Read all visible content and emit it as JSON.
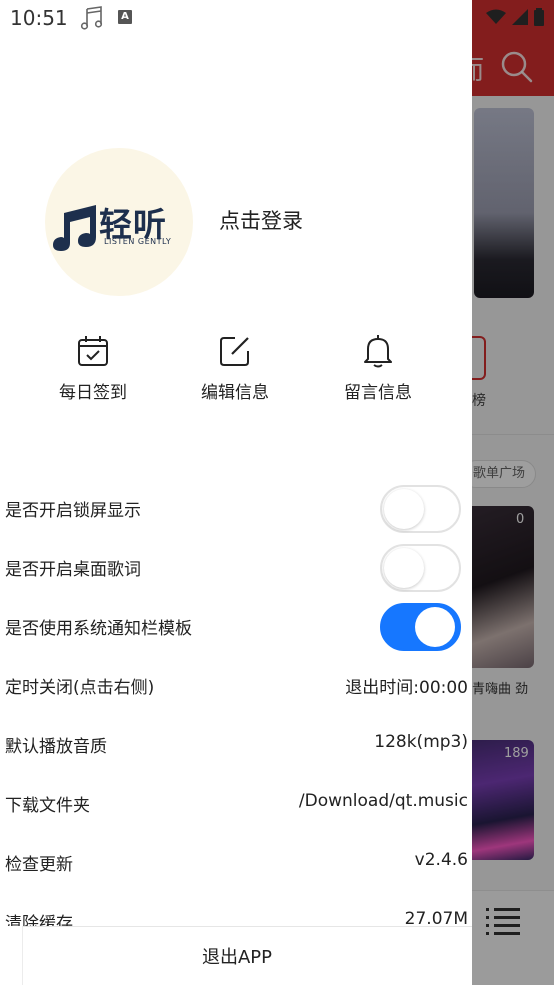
{
  "status": {
    "time": "10:51",
    "input_badge": "A"
  },
  "background_app": {
    "header_char": "而",
    "rank_label": "榜",
    "chip_label": "歌单广场",
    "card1_count": "0",
    "card1_caption": "青嗨曲 劲",
    "card2_count": "189",
    "accent_color": "#d32f2f"
  },
  "drawer": {
    "logo": {
      "name": "轻听",
      "tagline": "LISTEN GENTLY"
    },
    "login_label": "点击登录",
    "actions": [
      {
        "label": "每日签到",
        "icon": "calendar-check-icon"
      },
      {
        "label": "编辑信息",
        "icon": "edit-icon"
      },
      {
        "label": "留言信息",
        "icon": "bell-icon"
      }
    ],
    "settings": [
      {
        "label": "是否开启锁屏显示",
        "toggle": false
      },
      {
        "label": "是否开启桌面歌词",
        "toggle": false
      },
      {
        "label": "是否使用系统通知栏模板",
        "toggle": true
      },
      {
        "label": "定时关闭(点击右侧)",
        "value": "退出时间:00:00"
      },
      {
        "label": "默认播放音质",
        "value": "128k(mp3)"
      },
      {
        "label": "下载文件夹",
        "value": "/Download/qt.music"
      },
      {
        "label": "检查更新",
        "value": "v2.4.6"
      },
      {
        "label": "清除缓存",
        "value": "27.07M"
      }
    ],
    "exit_label": "退出APP",
    "toggle_on_color": "#1677ff"
  }
}
